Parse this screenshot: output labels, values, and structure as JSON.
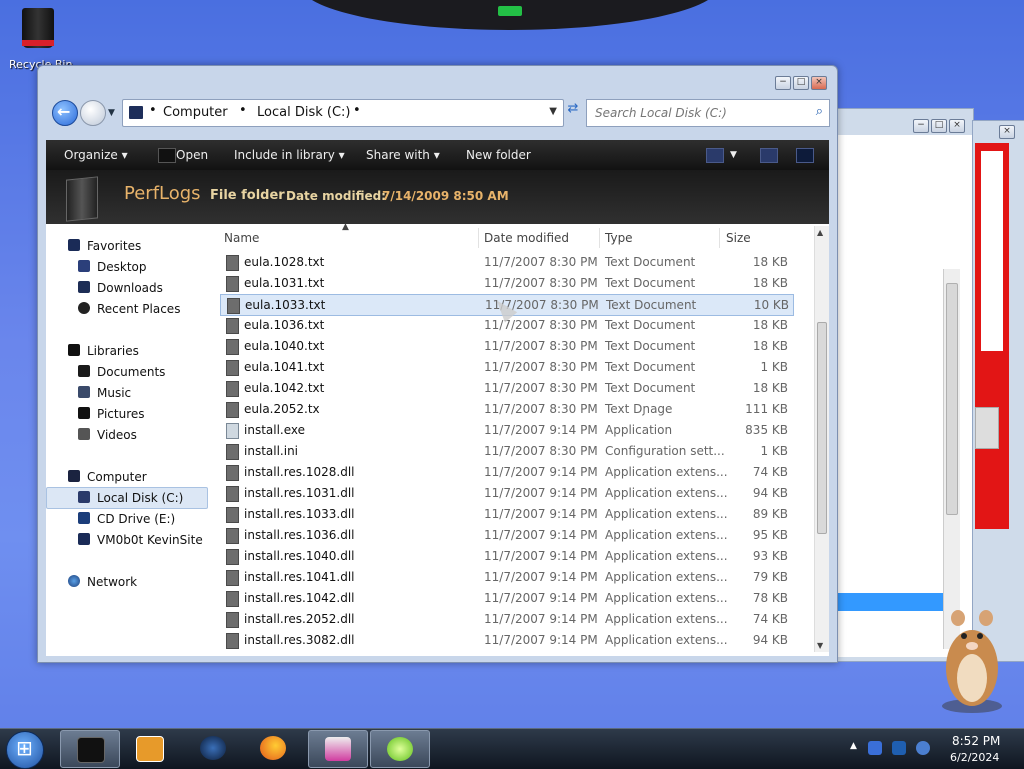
{
  "desktop": {
    "recycle_bin_label": "Recycle Bin"
  },
  "window": {
    "controls": {
      "minimize": "−",
      "maximize": "□",
      "close": "×"
    },
    "address": {
      "crumbs": [
        "Computer",
        "Local Disk (C:)"
      ],
      "separator": "•"
    },
    "search": {
      "placeholder": "Search Local Disk (C:)"
    },
    "toolbar": {
      "organize": "Organize ▾",
      "open": "Open",
      "include_in_library": "Include in library ▾",
      "share_with": "Share with ▾",
      "new_folder": "New folder"
    },
    "header": {
      "title": "PerfLogs",
      "kind": "File folder",
      "date_label": "Date modified:",
      "date_value": "7/14/2009 8:50 AM"
    }
  },
  "nav_pane": {
    "favorites": {
      "label": "Favorites",
      "items": [
        "Desktop",
        "Downloads",
        "Recent Places"
      ]
    },
    "libraries": {
      "label": "Libraries",
      "items": [
        "Documents",
        "Music",
        "Pictures",
        "Videos"
      ]
    },
    "computer": {
      "label": "Computer",
      "items": [
        "Local Disk (C:)",
        "CD Drive (E:)",
        "VM0b0t KevinSite"
      ]
    },
    "network": {
      "label": "Network"
    }
  },
  "file_list": {
    "columns": [
      "Name",
      "Date modified",
      "Type",
      "Size"
    ],
    "rows": [
      {
        "name": "eula.1028.txt",
        "date": "11/7/2007 8:30 PM",
        "type": "Text Document",
        "size": "18 KB"
      },
      {
        "name": "eula.1031.txt",
        "date": "11/7/2007 8:30 PM",
        "type": "Text Document",
        "size": "18 KB"
      },
      {
        "name": "eula.1033.txt",
        "date": "11/7/2007 8:30 PM",
        "type": "Text Document",
        "size": "10 KB"
      },
      {
        "name": "eula.1036.txt",
        "date": "11/7/2007 8:30 PM",
        "type": "Text Document",
        "size": "18 KB"
      },
      {
        "name": "eula.1040.txt",
        "date": "11/7/2007 8:30 PM",
        "type": "Text Document",
        "size": "18 KB"
      },
      {
        "name": "eula.1041.txt",
        "date": "11/7/2007 8:30 PM",
        "type": "Text Document",
        "size": "1 KB"
      },
      {
        "name": "eula.1042.txt",
        "date": "11/7/2007 8:30 PM",
        "type": "Text Document",
        "size": "18 KB"
      },
      {
        "name": "eula.2052.tx",
        "date": "11/7/2007 8:30 PM",
        "type": "Text Dɲage",
        "size": "111 KB"
      },
      {
        "name": "install.exe",
        "date": "11/7/2007 9:14 PM",
        "type": "Application",
        "size": "835 KB"
      },
      {
        "name": "install.ini",
        "date": "11/7/2007 8:30 PM",
        "type": "Configuration sett...",
        "size": "1 KB"
      },
      {
        "name": "install.res.1028.dll",
        "date": "11/7/2007 9:14 PM",
        "type": "Application extens...",
        "size": "74 KB"
      },
      {
        "name": "install.res.1031.dll",
        "date": "11/7/2007 9:14 PM",
        "type": "Application extens...",
        "size": "94 KB"
      },
      {
        "name": "install.res.1033.dll",
        "date": "11/7/2007 9:14 PM",
        "type": "Application extens...",
        "size": "89 KB"
      },
      {
        "name": "install.res.1036.dll",
        "date": "11/7/2007 9:14 PM",
        "type": "Application extens...",
        "size": "95 KB"
      },
      {
        "name": "install.res.1040.dll",
        "date": "11/7/2007 9:14 PM",
        "type": "Application extens...",
        "size": "93 KB"
      },
      {
        "name": "install.res.1041.dll",
        "date": "11/7/2007 9:14 PM",
        "type": "Application extens...",
        "size": "79 KB"
      },
      {
        "name": "install.res.1042.dll",
        "date": "11/7/2007 9:14 PM",
        "type": "Application extens...",
        "size": "78 KB"
      },
      {
        "name": "install.res.2052.dll",
        "date": "11/7/2007 9:14 PM",
        "type": "Application extens...",
        "size": "74 KB"
      },
      {
        "name": "install.res.3082.dll",
        "date": "11/7/2007 9:14 PM",
        "type": "Application extens...",
        "size": "94 KB"
      }
    ]
  },
  "taskbar": {
    "clock_time": "8:52 PM",
    "clock_date": "6/2/2024"
  },
  "colors": {
    "accent": "#3399ff",
    "header_text": "#e8b36a",
    "selection": "#dbe8f8"
  }
}
